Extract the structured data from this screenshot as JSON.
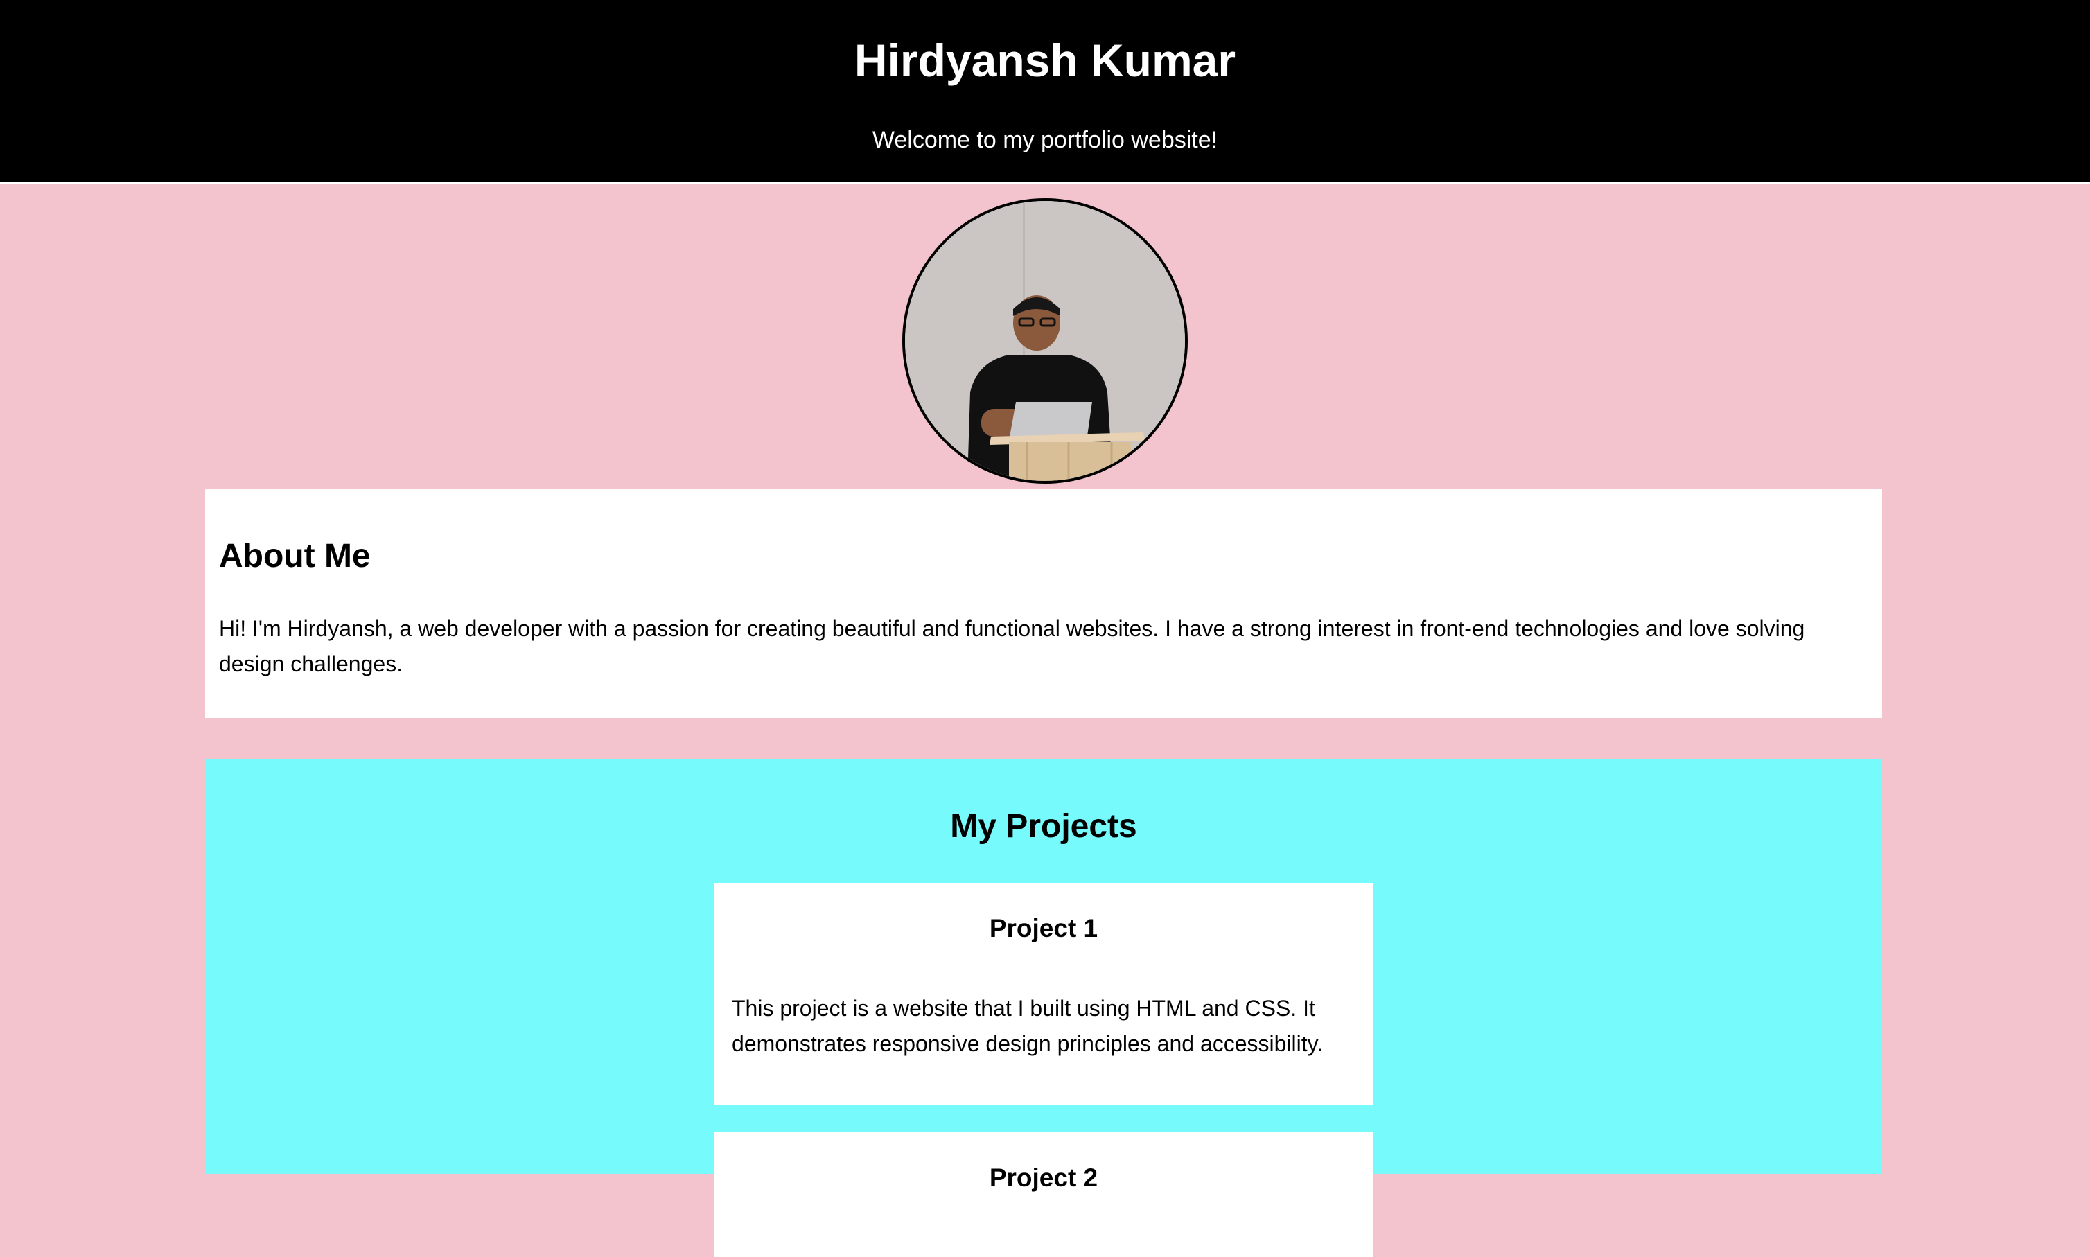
{
  "header": {
    "title": "Hirdyansh Kumar",
    "subtitle": "Welcome to my portfolio website!"
  },
  "about": {
    "heading": "About Me",
    "text": "Hi! I'm Hirdyansh, a web developer with a passion for creating beautiful and functional websites. I have a strong interest in front-end technologies and love solving design challenges."
  },
  "projects": {
    "heading": "My Projects",
    "items": [
      {
        "title": "Project 1",
        "description": "This project is a website that I built using HTML and CSS. It demonstrates responsive design principles and accessibility."
      },
      {
        "title": "Project 2",
        "description": ""
      }
    ]
  },
  "colors": {
    "page_background": "#f4c4ce",
    "header_background": "#000000",
    "header_text": "#ffffff",
    "card_background": "#ffffff",
    "projects_background": "#77fafc"
  },
  "icons": {
    "profile_photo": "profile-photo"
  }
}
